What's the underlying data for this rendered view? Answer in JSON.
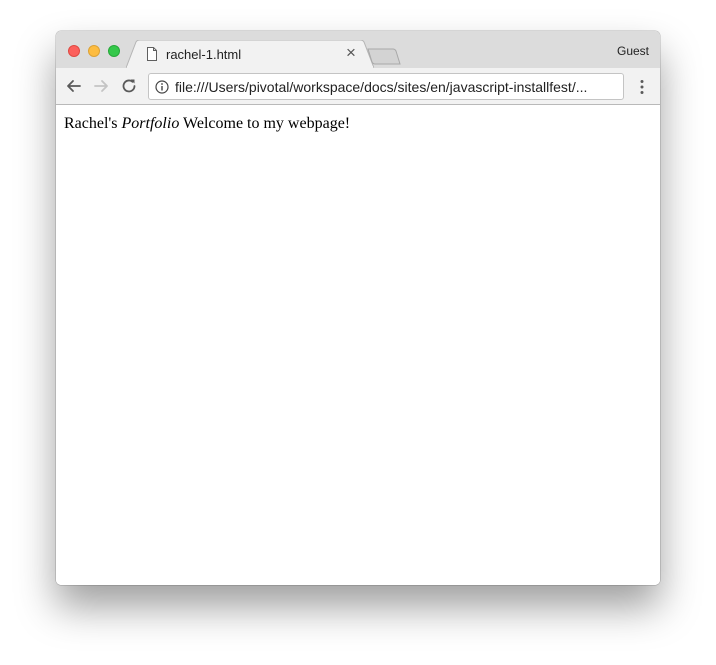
{
  "tab": {
    "title": "rachel-1.html",
    "close_glyph": "×",
    "favicon": "document-icon"
  },
  "profile": {
    "label": "Guest"
  },
  "toolbar": {
    "back_icon": "back-arrow-icon",
    "forward_icon": "forward-arrow-icon",
    "reload_icon": "reload-icon",
    "menu_icon": "kebab-menu-icon"
  },
  "omnibox": {
    "info_icon": "info-icon",
    "url": "file:///Users/pivotal/workspace/docs/sites/en/javascript-installfest/..."
  },
  "page": {
    "text_before": "Rachel's ",
    "text_italic": "Portfolio",
    "text_after": " Welcome to my webpage!"
  },
  "colors": {
    "close": "#fc605c",
    "minimize": "#fdbc40",
    "maximize": "#34c84a",
    "tabstrip": "#dcdcdc",
    "toolbar": "#f2f2f2"
  }
}
